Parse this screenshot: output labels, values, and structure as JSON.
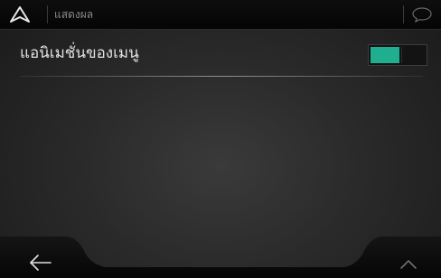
{
  "header": {
    "title": "แสดงผล",
    "logo_icon": "navigation-arrow-icon",
    "chat_icon": "speech-bubble-icon"
  },
  "settings": {
    "items": [
      {
        "label": "แอนิเมชั่นของเมนู",
        "toggle_state": "on"
      }
    ]
  },
  "bottom_bar": {
    "back_icon": "back-arrow-icon",
    "up_icon": "chevron-up-icon"
  },
  "colors": {
    "accent": "#1fae8f",
    "background": "#2a2a2a",
    "header_bg": "#0a0a0a",
    "text": "#e2e2e2",
    "muted_text": "#8a8a8a"
  }
}
